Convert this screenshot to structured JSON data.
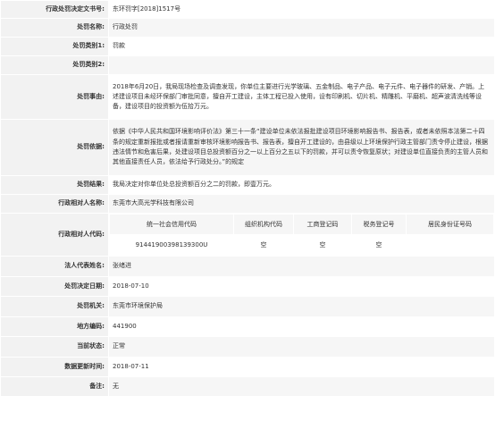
{
  "rows": {
    "doc_no": {
      "label": "行政处罚决定文书号:",
      "value": "东环罚字[2018]1517号"
    },
    "name": {
      "label": "处罚名称:",
      "value": "行政处罚"
    },
    "cat1": {
      "label": "处罚类别1:",
      "value": "罚款"
    },
    "cat2": {
      "label": "处罚类别2:",
      "value": ""
    },
    "reason": {
      "label": "处罚事由:",
      "value": "2018年6月20日，我局现场检查及调查发现，你单位主要进行光学玻璃、五金制品、电子产品、电子元件、电子器件的研发、产销。上述建设项目未经环保部门审批同意，擅自开工建设，主体工程已投入使用，设有印刷机、切片机、精雕机、平磨机、超声波清洗线等设备，建设项目的投资额为伍拾万元。"
    },
    "basis": {
      "label": "处罚依据:",
      "value": "依据《中华人民共和国环境影响评价法》第三十一条“建设单位未依法报批建设项目环境影响报告书、报告表，或者未依照本法第二十四条的规定重新报批或者报请重新审核环境影响报告书、报告表，擅自开工建设的，由县级以上环境保护行政主管部门责令停止建设，根据违法情节和危害后果，处建设项目总投资额百分之一以上百分之五以下的罚款，并可以责令恢复原状；对建设单位直接负责的主管人员和其他直接责任人员，依法给予行政处分。”的规定"
    },
    "result": {
      "label": "处罚结果:",
      "value": "我局决定对你单位处总投资额百分之二的罚款，即壹万元。"
    },
    "party_name": {
      "label": "行政相对人名称:",
      "value": "东莞市大高光学科技有限公司"
    },
    "party_code": {
      "label": "行政相对人代码:"
    },
    "legal_rep": {
      "label": "法人代表姓名:",
      "value": "张绪进"
    },
    "decision_date": {
      "label": "处罚决定日期:",
      "value": "2018-07-10"
    },
    "authority": {
      "label": "处罚机关:",
      "value": "东莞市环境保护局"
    },
    "region_code": {
      "label": "地方编码:",
      "value": "441900"
    },
    "status": {
      "label": "当前状态:",
      "value": "正常"
    },
    "updated": {
      "label": "数据更新时间:",
      "value": "2018-07-11"
    },
    "remark": {
      "label": "备注:",
      "value": "无"
    }
  },
  "id_table": {
    "headers": [
      "统一社会信用代码",
      "组织机构代码",
      "工商登记码",
      "税务登记号",
      "居民身份证号码"
    ],
    "values": [
      "91441900398139300U",
      "空",
      "空",
      "空",
      ""
    ]
  }
}
